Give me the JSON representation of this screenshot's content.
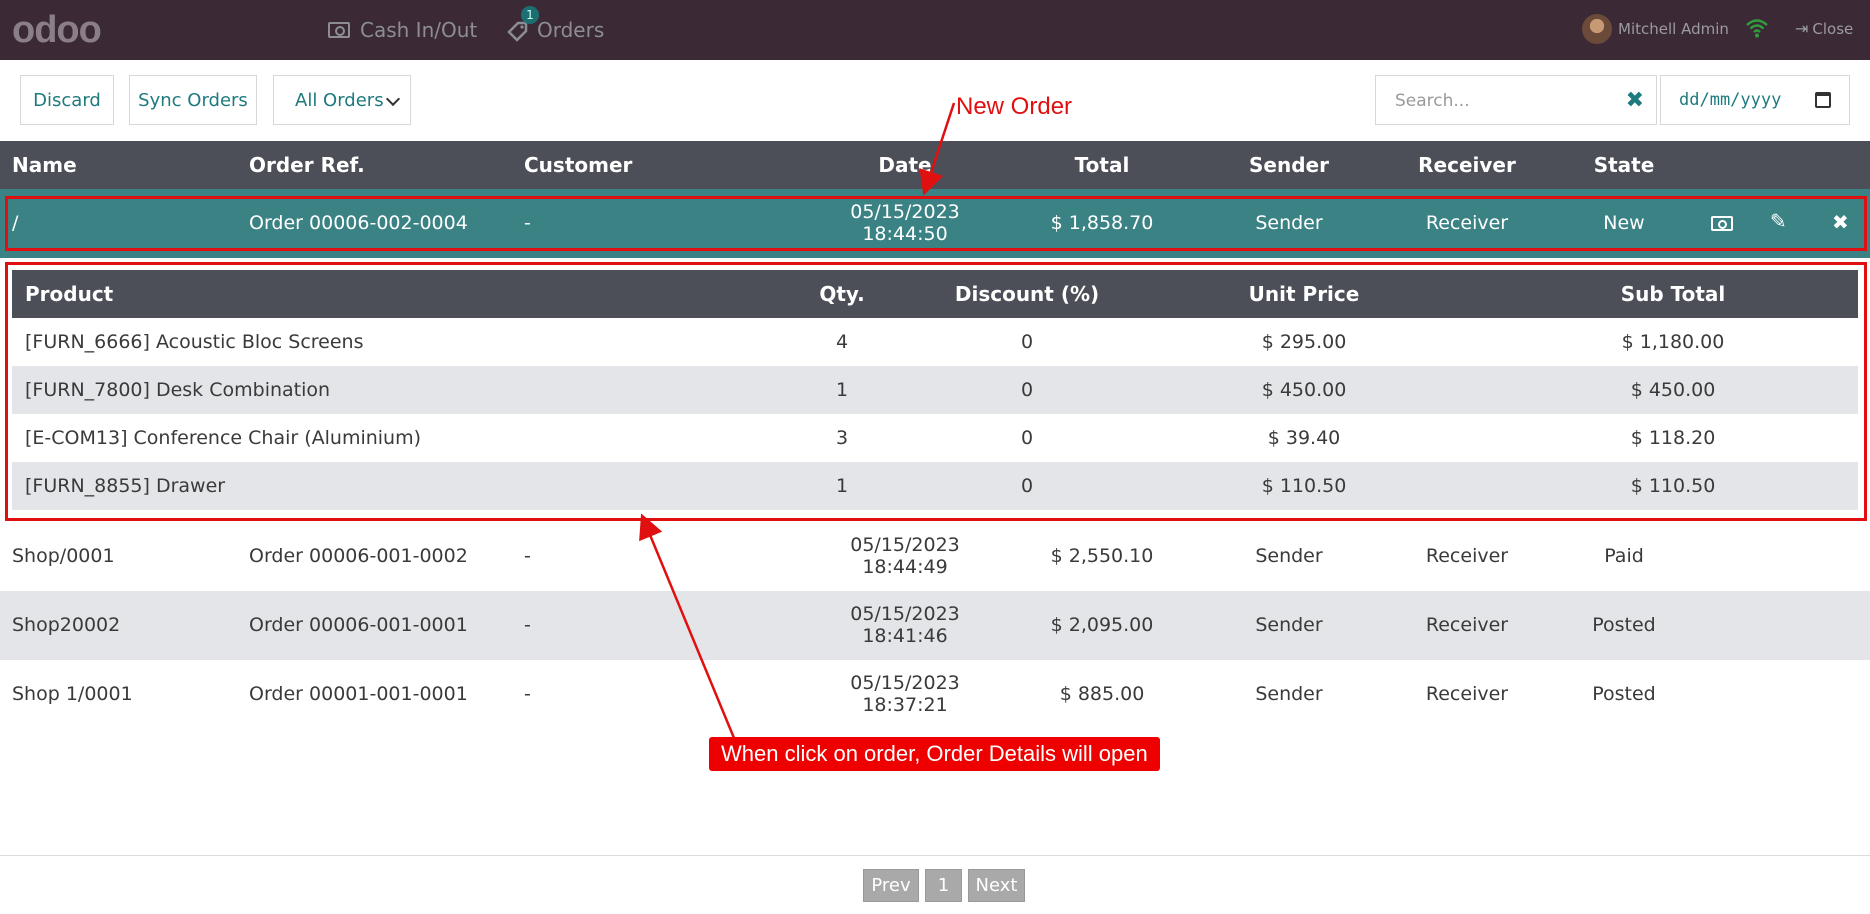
{
  "topbar": {
    "logo": "odoo",
    "cash_label": "Cash In/Out",
    "orders_label": "Orders",
    "orders_badge": "1",
    "user_name": "Mitchell Admin",
    "close_label": "Close"
  },
  "controls": {
    "discard_label": "Discard",
    "sync_label": "Sync Orders",
    "filter_value": "All Orders",
    "search_placeholder": "Search...",
    "date_placeholder": "dd/mm/yyyy"
  },
  "orders": {
    "columns": [
      "Name",
      "Order Ref.",
      "Customer",
      "Date",
      "Total",
      "Sender",
      "Receiver",
      "State"
    ],
    "rows": [
      {
        "name": "/",
        "ref": "Order 00006-002-0004",
        "customer": "-",
        "date": "05/15/2023",
        "time": "18:44:50",
        "total": "$ 1,858.70",
        "sender": "Sender",
        "receiver": "Receiver",
        "state": "New"
      },
      {
        "name": "Shop/0001",
        "ref": "Order 00006-001-0002",
        "customer": "-",
        "date": "05/15/2023",
        "time": "18:44:49",
        "total": "$ 2,550.10",
        "sender": "Sender",
        "receiver": "Receiver",
        "state": "Paid"
      },
      {
        "name": "Shop20002",
        "ref": "Order 00006-001-0001",
        "customer": "-",
        "date": "05/15/2023",
        "time": "18:41:46",
        "total": "$ 2,095.00",
        "sender": "Sender",
        "receiver": "Receiver",
        "state": "Posted"
      },
      {
        "name": "Shop 1/0001",
        "ref": "Order 00001-001-0001",
        "customer": "-",
        "date": "05/15/2023",
        "time": "18:37:21",
        "total": "$ 885.00",
        "sender": "Sender",
        "receiver": "Receiver",
        "state": "Posted"
      }
    ]
  },
  "details": {
    "columns": [
      "Product",
      "Qty.",
      "Discount (%)",
      "Unit Price",
      "Sub Total"
    ],
    "rows": [
      {
        "product": "[FURN_6666] Acoustic Bloc Screens",
        "qty": "4",
        "discount": "0",
        "unit": "$ 295.00",
        "subtotal": "$ 1,180.00"
      },
      {
        "product": "[FURN_7800] Desk Combination",
        "qty": "1",
        "discount": "0",
        "unit": "$ 450.00",
        "subtotal": "$ 450.00"
      },
      {
        "product": "[E-COM13] Conference Chair (Aluminium)",
        "qty": "3",
        "discount": "0",
        "unit": "$ 39.40",
        "subtotal": "$ 118.20"
      },
      {
        "product": "[FURN_8855] Drawer",
        "qty": "1",
        "discount": "0",
        "unit": "$ 110.50",
        "subtotal": "$ 110.50"
      }
    ]
  },
  "annotations": {
    "new_order": "New Order",
    "click_hint": "When click on order, Order Details will open",
    "color": "#e01010"
  },
  "pagination": {
    "prev": "Prev",
    "page": "1",
    "next": "Next"
  },
  "colors": {
    "topbar": "#3b2a35",
    "header": "#4c4f57",
    "selected_row": "#3a8284",
    "accent": "#1f7a7e"
  }
}
